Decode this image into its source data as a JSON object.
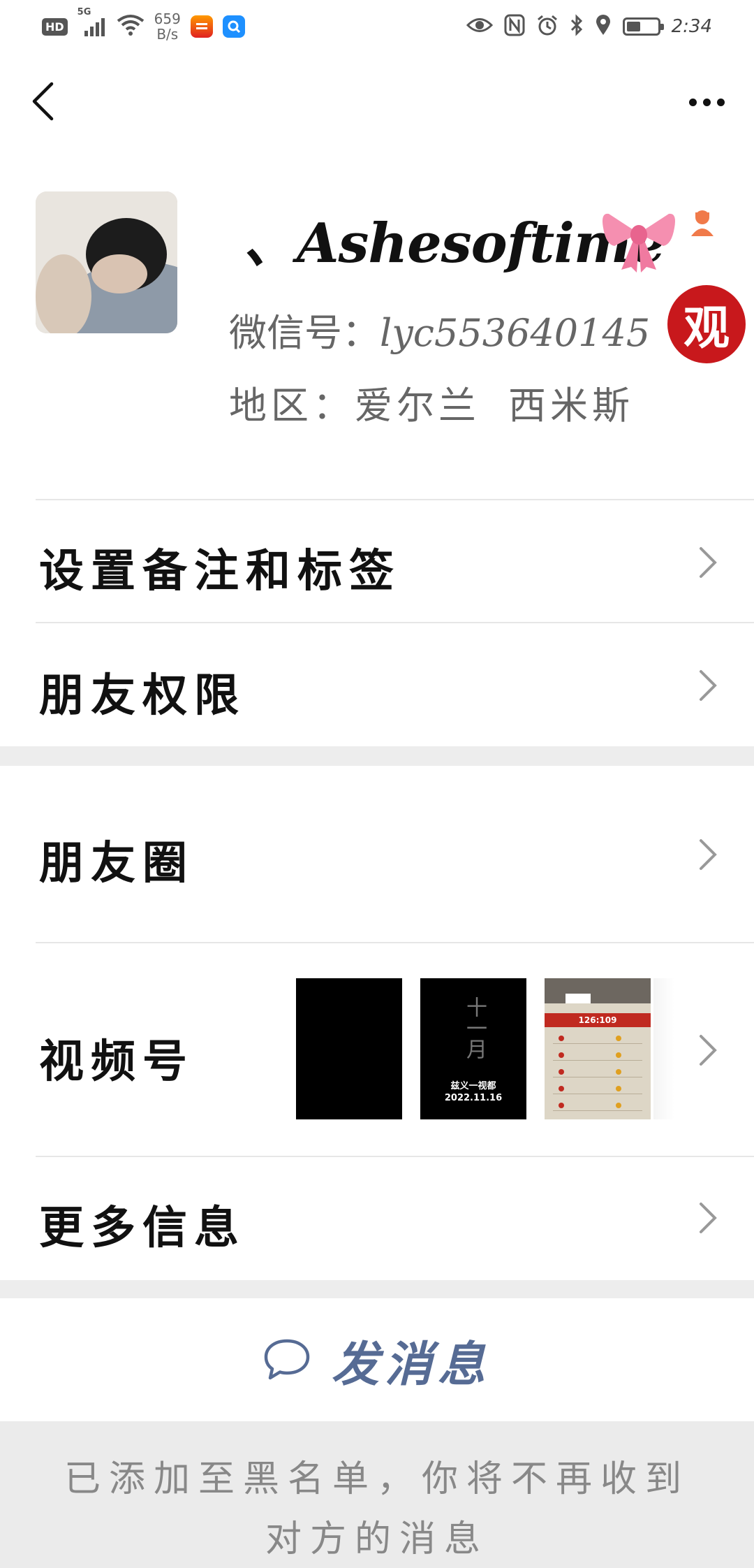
{
  "status_bar": {
    "hd": "HD",
    "network": "5G",
    "speed_value": "659",
    "speed_unit": "B/s",
    "time": "2:34",
    "battery_level": 0.45
  },
  "profile": {
    "nickname": "、Ashesoftime",
    "wechat_id_label": "微信号：",
    "wechat_id": "lyc553640145",
    "region_label": "地区：",
    "region_country": "爱尔兰",
    "region_city": "西米斯",
    "float_badge": "观"
  },
  "menu": {
    "remark_tags": "设置备注和标签",
    "friend_permissions": "朋友权限",
    "moments": "朋友圈",
    "channels": "视频号",
    "more_info": "更多信息"
  },
  "channels_thumbs": {
    "thumb2_title": "十一月",
    "thumb2_caption_line1": "兹义一视都",
    "thumb2_caption_line2": "2022.11.16",
    "thumb3_score": "126:109"
  },
  "actions": {
    "send_message": "发消息"
  },
  "notice": {
    "blacklist_text": "已添加至黑名单，你将不再收到对方的消息"
  }
}
